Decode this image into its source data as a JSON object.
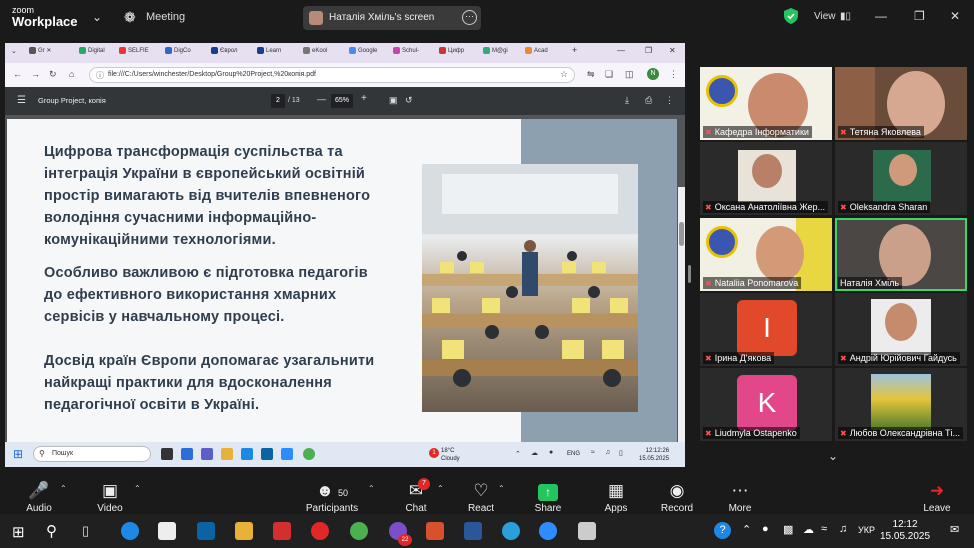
{
  "zoom_top": {
    "logo_line1": "zoom",
    "logo_line2": "Workplace",
    "meeting_label": "Meeting",
    "screen_share_label": "Наталія Хміль's screen",
    "view_label": "View",
    "colors": {
      "shield": "#22c55e"
    }
  },
  "browser": {
    "tabs": [
      "Gr",
      "Digital",
      "SELFIE",
      "DigCo",
      "Єврол",
      "Learn",
      "eKool",
      "Google",
      "Schul-",
      "Цифр",
      "M@gi",
      "Acad"
    ],
    "url": "file:///C:/Users/winchester/Desktop/Group%20Project,%20копія.pdf",
    "profile_initial": "N"
  },
  "pdf": {
    "title": "Group Project, копія",
    "page": "2",
    "total": "/ 13",
    "zoom": "65%"
  },
  "slide": {
    "para1": [
      "Цифрова трансформація суспільства та",
      "інтеграція України в європейський освітній",
      "простір вимагають від вчителів впевненого",
      "володіння сучасними інформаційно-",
      "комунікаційними технологіями."
    ],
    "para2": [
      "Особливо важливою є підготовка педагогів",
      "до ефективного використання хмарних",
      "сервісів у навчальному процесі."
    ],
    "para3": [
      "Досвід країн Європи допомагає узагальнити",
      "найкращі практики для вдосконалення",
      "педагогічної освіти в Україні."
    ]
  },
  "inner_taskbar": {
    "search_placeholder": "Пошук",
    "weather_temp": "18°C",
    "weather_desc": "Cloudy",
    "weather_badge": "1",
    "lang": "ENG",
    "time": "12:12:26",
    "date": "15.05.2025"
  },
  "participants": [
    {
      "name": "Кафедра Інформатики",
      "muted": true
    },
    {
      "name": "Тетяна Яковлева",
      "muted": true
    },
    {
      "name": "Оксана Анатоліївна Жер...",
      "muted": true
    },
    {
      "name": "Oleksandra Sharan",
      "muted": true
    },
    {
      "name": "Nataliia Ponomarova",
      "muted": true
    },
    {
      "name": "Наталія Хміль",
      "muted": false,
      "active_speaker": true
    },
    {
      "name": "Ірина Д'якова",
      "muted": true,
      "initial": "I"
    },
    {
      "name": "Андрій Юрійович Гайдусь",
      "muted": true
    },
    {
      "name": "Liudmyla Ostapenko",
      "muted": true,
      "initial": "K"
    },
    {
      "name": "Любов Олександрівна Ті...",
      "muted": true
    }
  ],
  "controls": {
    "audio": "Audio",
    "video": "Video",
    "participants": "Participants",
    "participants_count": "50",
    "chat": "Chat",
    "chat_badge": "7",
    "react": "React",
    "share": "Share",
    "apps": "Apps",
    "record": "Record",
    "more": "More",
    "leave": "Leave",
    "colors": {
      "share": "#22c55e",
      "leave": "#e02828"
    }
  },
  "windows_taskbar": {
    "lang": "УКР",
    "time": "12:12",
    "date": "15.05.2025",
    "viber_badge": "22"
  }
}
